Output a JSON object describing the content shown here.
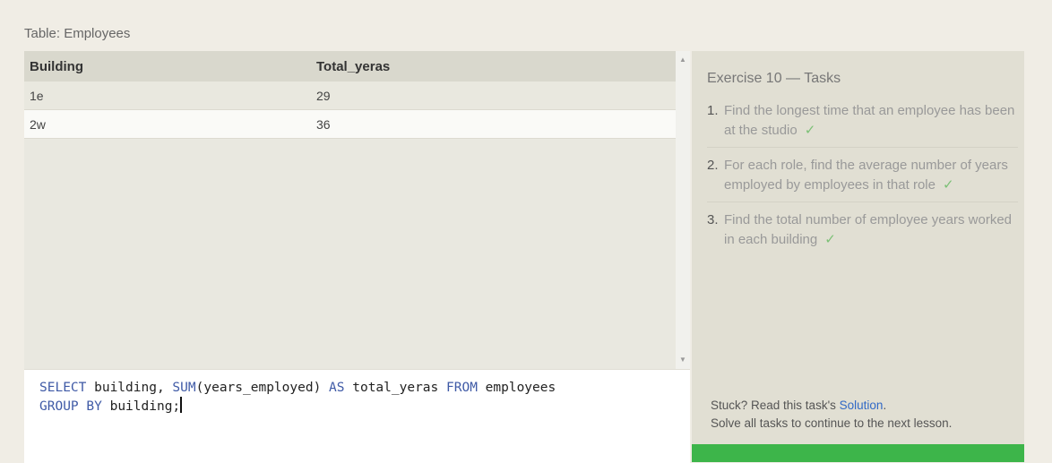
{
  "table_caption": "Table: Employees",
  "results": {
    "columns": [
      "Building",
      "Total_yeras"
    ],
    "rows": [
      [
        "1e",
        "29"
      ],
      [
        "2w",
        "36"
      ]
    ]
  },
  "editor": {
    "line1": {
      "t1": "SELECT",
      "t2": " building, ",
      "t3": "SUM",
      "t4": "(years_employed) ",
      "t5": "AS",
      "t6": " total_yeras ",
      "t7": "FROM",
      "t8": " employees"
    },
    "line2": {
      "t1": "GROUP",
      "t2": " ",
      "t3": "BY",
      "t4": " building;"
    }
  },
  "exercise": {
    "title": "Exercise 10 — Tasks",
    "tasks": [
      {
        "num": "1.",
        "text": "Find the longest time that an employee has been at the studio",
        "check": "✓"
      },
      {
        "num": "2.",
        "text": "For each role, find the average number of years employed by employees in that role",
        "check": "✓"
      },
      {
        "num": "3.",
        "text": "Find the total number of employee years worked in each building",
        "check": "✓"
      }
    ]
  },
  "help": {
    "stuck_prefix": "Stuck? Read this task's ",
    "solution_link": "Solution",
    "stuck_suffix": ".",
    "continue_text": "Solve all tasks to continue to the next lesson."
  },
  "colors": {
    "keyword": "#3f5aa6",
    "check": "#7cc076",
    "next_bar": "#3db54a",
    "link": "#3169c6"
  }
}
